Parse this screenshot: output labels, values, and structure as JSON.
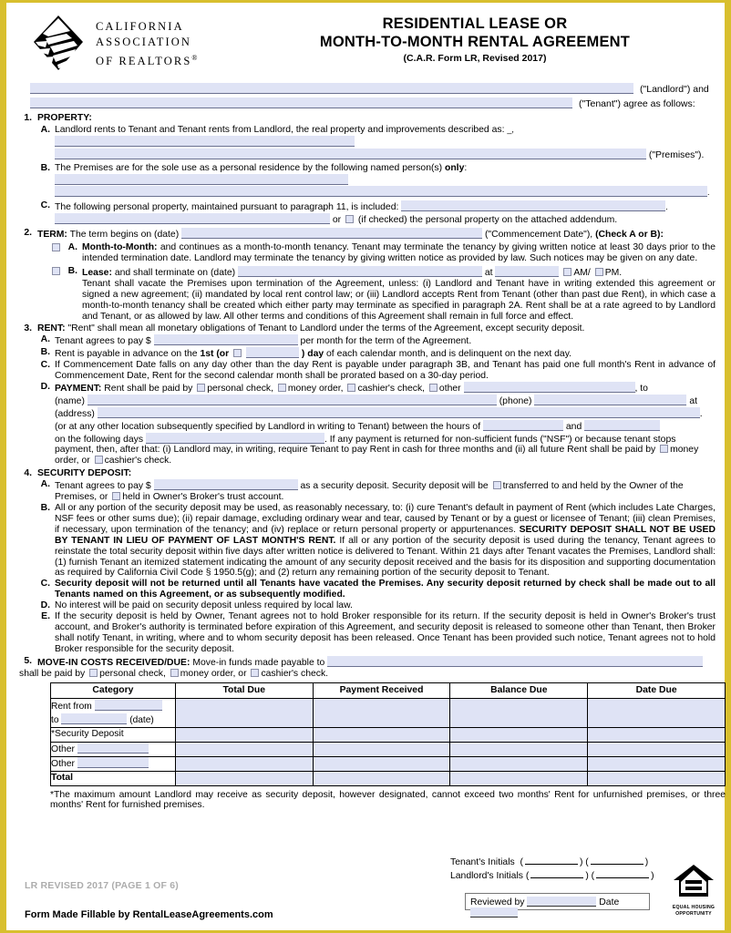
{
  "brand": {
    "org_line1": "CALIFORNIA",
    "org_line2": "ASSOCIATION",
    "org_line3": "OF REALTORS",
    "registered_mark": "®",
    "logo_icon": "car-diamond-logo"
  },
  "header": {
    "title_line1": "RESIDENTIAL LEASE OR",
    "title_line2": "MONTH-TO-MONTH RENTAL AGREEMENT",
    "form_id": "(C.A.R. Form LR, Revised 2017)"
  },
  "parties": {
    "landlord_suffix": "(\"Landlord\") and",
    "tenant_suffix": "(\"Tenant\") agree as follows:"
  },
  "colors": {
    "page_border": "#d8bf2e",
    "field_fill": "#dfe3f5",
    "field_underline": "#6b7190",
    "checkbox_border": "#8b8fa6",
    "text": "#000000"
  },
  "sections": [
    {
      "num": "1.",
      "heading": "PROPERTY:",
      "items": [
        {
          "letter": "A.",
          "text_before": "Landlord rents to Tenant and Tenant rents from Landlord, the real property and improvements described as:",
          "trailing_label": "(\"Premises\")."
        },
        {
          "letter": "B.",
          "text_before": "The Premises are for the sole use as a personal residence by the following named person(s)",
          "bold_word": "only",
          "colon": ":"
        },
        {
          "letter": "C.",
          "text_before": "The following personal property, maintained pursuant to paragraph 11, is included:",
          "or_label": "or",
          "checkbox_text": "(if checked) the personal property on the attached addendum."
        }
      ]
    },
    {
      "num": "2.",
      "heading": "TERM:",
      "lead_text": "The term begins on (date)",
      "lead_suffix": "(\"Commencement Date\"),",
      "lead_bold_suffix": "(Check A or B):",
      "items": [
        {
          "letter": "A.",
          "bold_label": "Month-to-Month:",
          "text": "and continues as a month-to-month tenancy. Tenant may terminate the tenancy by giving written notice at least 30 days prior to the intended termination date. Landlord may terminate the tenancy by giving written notice as provided by law. Such notices may be given on any date."
        },
        {
          "letter": "B.",
          "bold_label": "Lease:",
          "text": "and shall terminate on (date)",
          "at_label": "at",
          "am_label": "AM/",
          "pm_label": "PM.",
          "paragraph": "Tenant shall vacate the Premises upon termination of the Agreement, unless: (i) Landlord and Tenant have in writing extended this agreement or signed a new agreement; (ii) mandated by local rent control law; or (iii) Landlord accepts Rent from Tenant (other than past due Rent), in which case a month-to-month tenancy shall be created which either party may terminate as specified in paragraph 2A. Rent shall be at a rate agreed to by Landlord and Tenant, or as allowed by law. All other terms and conditions of this Agreement shall remain in full force and effect."
        }
      ]
    },
    {
      "num": "3.",
      "heading": "RENT:",
      "lead_text": "\"Rent\" shall mean all monetary obligations of Tenant to Landlord under the terms of the Agreement, except security deposit.",
      "items": [
        {
          "letter": "A.",
          "text_before": "Tenant agrees to pay $",
          "text_after": "per month for the term of the Agreement."
        },
        {
          "letter": "B.",
          "text_before": "Rent is payable in advance on the",
          "bold_1st": "1st (or",
          "bold_day": ") day",
          "text_after": "of each calendar month, and is delinquent on the next day."
        },
        {
          "letter": "C.",
          "text": "If Commencement Date falls on any day other than the day Rent is payable under paragraph 3B, and Tenant has paid one full month's Rent in advance of Commencement Date, Rent for the second calendar month shall be prorated based on a 30-day period."
        },
        {
          "letter": "D.",
          "bold_label": "PAYMENT:",
          "text_before": "Rent shall be paid by",
          "opt1": "personal check,",
          "opt2": "money order,",
          "opt3": "cashier's check,",
          "opt4": "other",
          "to_label": ", to",
          "name_label": "(name)",
          "phone_label": "(phone)",
          "at_label": "at",
          "address_label": "(address)",
          "period": ".",
          "hours_before": "(or at any other location subsequently specified by Landlord in writing to Tenant) between the hours of",
          "and_label": "and",
          "days_before": "on the following days",
          "days_after": ". If any payment is returned for non-sufficient funds (\"NSF\") or because tenant stops payment, then, after that: (i) Landlord may, in writing, require Tenant to pay Rent in cash for three months and (ii) all future Rent shall be paid by",
          "pay_opt1": "money order, or",
          "pay_opt2": "cashier's check."
        }
      ]
    },
    {
      "num": "4.",
      "heading": "SECURITY DEPOSIT:",
      "items": [
        {
          "letter": "A.",
          "text_before": "Tenant agrees to pay $",
          "text_mid": "as a security deposit. Security deposit will be",
          "opt1": "transferred to and held by the Owner of the Premises, or",
          "opt2": "held in Owner's Broker's trust account."
        },
        {
          "letter": "B.",
          "text_part1": "All or any portion of the security deposit may be used, as reasonably necessary, to: (i) cure Tenant's default in payment of Rent (which includes Late Charges, NSF fees or other sums due); (ii) repair damage, excluding ordinary wear and tear, caused by Tenant or by a guest or licensee of Tenant; (iii) clean Premises, if necessary, upon termination of the tenancy; and (iv) replace or return personal property or appurtenances.",
          "bold_caps": "SECURITY DEPOSIT SHALL NOT BE USED BY TENANT IN LIEU OF PAYMENT OF LAST MONTH'S RENT.",
          "text_part2": "If all or any portion of the security deposit is used during the tenancy, Tenant agrees to reinstate the total security deposit within five days after written notice is delivered to Tenant. Within 21 days after Tenant vacates the Premises, Landlord shall: (1) furnish Tenant an itemized statement indicating the amount of any security deposit received and the basis for its disposition and supporting documentation as required by California Civil Code § 1950.5(g); and (2) return any remaining portion of the security deposit to Tenant."
        },
        {
          "letter": "C.",
          "bold_text": "Security deposit will not be returned until all Tenants have vacated the Premises. Any security deposit returned by check shall be made out to all Tenants named on this Agreement, or as subsequently modified."
        },
        {
          "letter": "D.",
          "text": "No interest will be paid on security deposit unless required by local law."
        },
        {
          "letter": "E.",
          "text": "If the security deposit is held by Owner, Tenant agrees not to hold Broker responsible for its return. If the security deposit is held in Owner's Broker's trust account, and Broker's authority is terminated before expiration of this Agreement, and security deposit is released to someone other than Tenant, then Broker shall notify Tenant, in writing, where and to whom security deposit has been released. Once Tenant has been provided such notice, Tenant agrees not to hold Broker responsible for the security deposit."
        }
      ]
    },
    {
      "num": "5.",
      "heading": "MOVE-IN COSTS RECEIVED/DUE:",
      "lead_text": "Move-in funds made payable to",
      "line2_before": "shall be paid by",
      "opt1": "personal check,",
      "opt2": "money order, or",
      "opt3": "cashier's check."
    }
  ],
  "costs_table": {
    "headers": [
      "Category",
      "Total Due",
      "Payment Received",
      "Balance Due",
      "Date Due"
    ],
    "rows": [
      {
        "category_prefix": "Rent from",
        "category_line2_prefix": "to",
        "category_line2_suffix": "(date)",
        "has_fields": true
      },
      {
        "category": "*Security Deposit"
      },
      {
        "category_prefix": "Other",
        "has_field": true
      },
      {
        "category_prefix": "Other",
        "has_field": true
      },
      {
        "category": "Total",
        "bold": true
      }
    ]
  },
  "footnote": "*The maximum amount Landlord may receive as security deposit, however designated, cannot exceed two months' Rent for unfurnished premises, or three months' Rent for furnished premises.",
  "footer": {
    "tenant_initials_label": "Tenant's Initials",
    "landlord_initials_label": "Landlord's Initials",
    "reviewed_by_label": "Reviewed by",
    "date_label": "Date",
    "equal_housing_line1": "EQUAL HOUSING",
    "equal_housing_line2": "OPPORTUNITY",
    "equal_housing_icon": "equal-housing-opportunity-icon",
    "revision_line": "LR REVISED 2017 (PAGE 1 OF 6)",
    "fillable_credit": "Form Made Fillable by RentalLeaseAgreements.com"
  }
}
